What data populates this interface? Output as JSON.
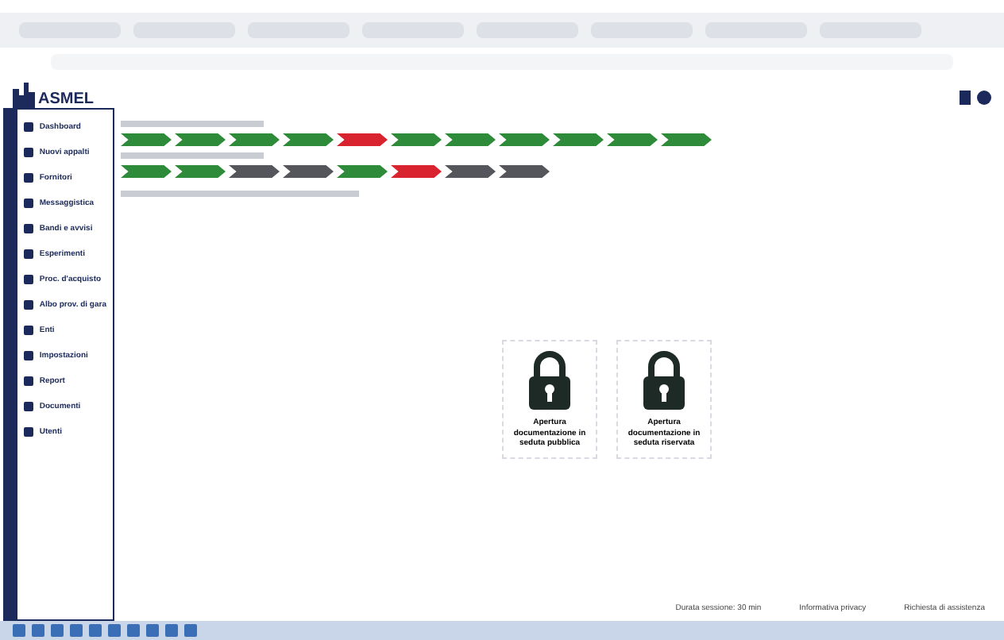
{
  "header": {
    "logo": "ASMEL"
  },
  "sidebar": {
    "items": [
      {
        "label": "Dashboard"
      },
      {
        "label": "Nuovi appalti"
      },
      {
        "label": "Fornitori"
      },
      {
        "label": "Messaggistica"
      },
      {
        "label": "Bandi e avvisi"
      },
      {
        "label": "Esperimenti"
      },
      {
        "label": "Proc. d'acquisto"
      },
      {
        "label": "Albo prov. di gara"
      },
      {
        "label": "Enti"
      },
      {
        "label": "Impostazioni"
      },
      {
        "label": "Report"
      },
      {
        "label": "Documenti"
      },
      {
        "label": "Utenti"
      }
    ]
  },
  "steps_top": [
    {
      "color": "#2e8b3a"
    },
    {
      "color": "#2e8b3a"
    },
    {
      "color": "#2e8b3a"
    },
    {
      "color": "#2e8b3a"
    },
    {
      "color": "#d9232e"
    },
    {
      "color": "#2e8b3a"
    },
    {
      "color": "#2e8b3a"
    },
    {
      "color": "#2e8b3a"
    },
    {
      "color": "#2e8b3a"
    },
    {
      "color": "#2e8b3a"
    },
    {
      "color": "#2e8b3a"
    }
  ],
  "steps_bottom": [
    {
      "color": "#2e8b3a"
    },
    {
      "color": "#2e8b3a"
    },
    {
      "color": "#55555c"
    },
    {
      "color": "#55555c"
    },
    {
      "color": "#2e8b3a"
    },
    {
      "color": "#d9232e"
    },
    {
      "color": "#55555c"
    },
    {
      "color": "#55555c"
    }
  ],
  "cards": [
    {
      "label": "Apertura documentazione in seduta pubblica"
    },
    {
      "label": "Apertura documentazione in seduta riservata"
    }
  ],
  "footer": {
    "session": "Durata sessione: 30 min",
    "privacy": "Informativa privacy",
    "support": "Richiesta di assistenza"
  }
}
